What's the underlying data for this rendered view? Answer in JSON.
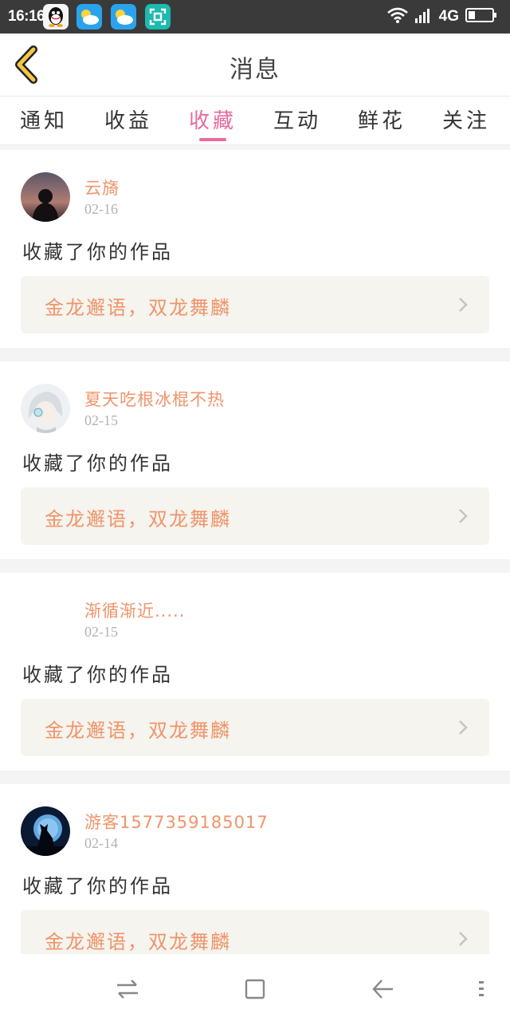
{
  "status_bar": {
    "time": "16:16",
    "network": "4G",
    "apps": [
      "qq-icon",
      "weather-icon",
      "weather-icon",
      "scanner-icon"
    ]
  },
  "header": {
    "title": "消息",
    "back_icon": "chevron-left-icon"
  },
  "tabs": [
    {
      "label": "通知",
      "active": false
    },
    {
      "label": "收益",
      "active": false
    },
    {
      "label": "收藏",
      "active": true
    },
    {
      "label": "互动",
      "active": false
    },
    {
      "label": "鲜花",
      "active": false
    },
    {
      "label": "关注",
      "active": false
    }
  ],
  "messages": [
    {
      "username": "云旖",
      "date": "02-16",
      "action": "收藏了你的作品",
      "work": "金龙邂语，双龙舞麟",
      "avatar": "avatar-silhouette"
    },
    {
      "username": "夏天吃根冰棍不热",
      "date": "02-15",
      "action": "收藏了你的作品",
      "work": "金龙邂语，双龙舞麟",
      "avatar": "avatar-anime"
    },
    {
      "username": "渐循渐近.....",
      "date": "02-15",
      "action": "收藏了你的作品",
      "work": "金龙邂语，双龙舞麟",
      "avatar": "avatar-empty"
    },
    {
      "username": "游客1577359185017",
      "date": "02-14",
      "action": "收藏了你的作品",
      "work": "金龙邂语，双龙舞麟",
      "avatar": "avatar-wolf"
    }
  ],
  "colors": {
    "accent_pink": "#e86aa0",
    "accent_orange": "#f0946a",
    "back_icon_yellow": "#f2c744"
  }
}
